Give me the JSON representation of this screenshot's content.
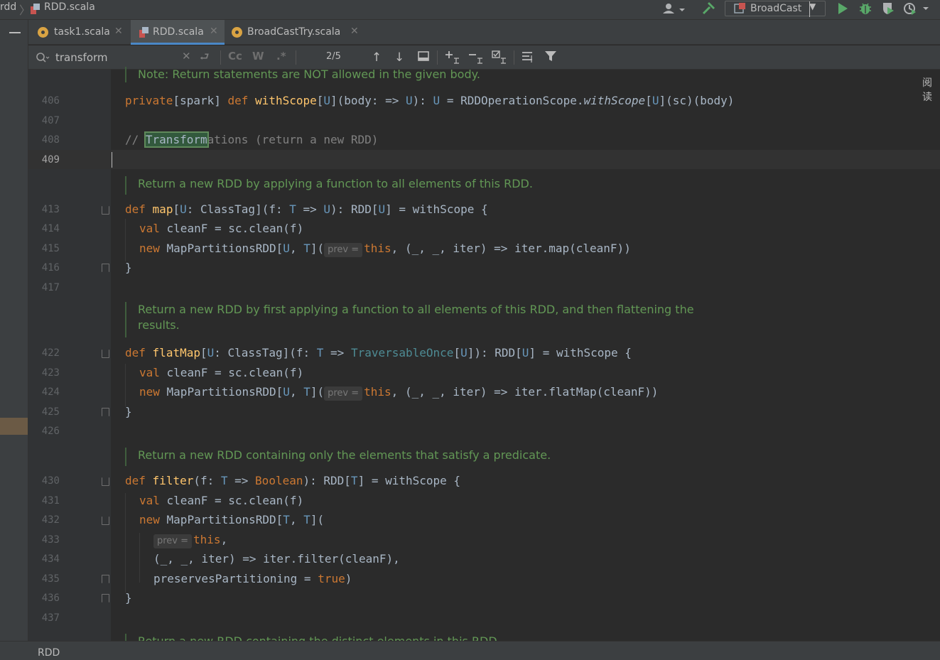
{
  "titlebar": {
    "breadcrumb_prev": "rdd",
    "file_name": "RDD.scala",
    "run_config": "BroadCast"
  },
  "tabs": [
    {
      "label": "task1.scala",
      "active": false
    },
    {
      "label": "RDD.scala",
      "active": true
    },
    {
      "label": "BroadCastTry.scala",
      "active": false
    }
  ],
  "search": {
    "query": "transform",
    "match_count": "2/5",
    "case_label": "Cc",
    "words_label": "W",
    "regex_label": ".*"
  },
  "side_label": "阅读",
  "status": {
    "text": "RDD"
  },
  "editor": {
    "doc_top": "Note: Return statements are NOT allowed in the given body.",
    "doc_map": "Return a new RDD by applying a function to all elements of this RDD.",
    "doc_flatmap_1": "Return a new RDD by first applying a function to all elements of this RDD, and then flattening the",
    "doc_flatmap_2": "results.",
    "doc_filter": "Return a new RDD containing only the elements that satisfy a predicate.",
    "doc_distinct": "Return a new RDD containing the distinct elements in this RDD.",
    "inlay_hint": "prev =",
    "line_numbers": [
      "406",
      "407",
      "408",
      "409",
      "413",
      "414",
      "415",
      "416",
      "417",
      "422",
      "423",
      "424",
      "425",
      "426",
      "430",
      "431",
      "432",
      "433",
      "434",
      "435",
      "436",
      "437"
    ]
  },
  "colors": {
    "background": "#2b2b2b",
    "keyword": "#cc7832",
    "function": "#ffc66d",
    "type_param": "#6897bb",
    "doc_comment": "#629755",
    "tab_active_underline": "#4a88c7"
  }
}
